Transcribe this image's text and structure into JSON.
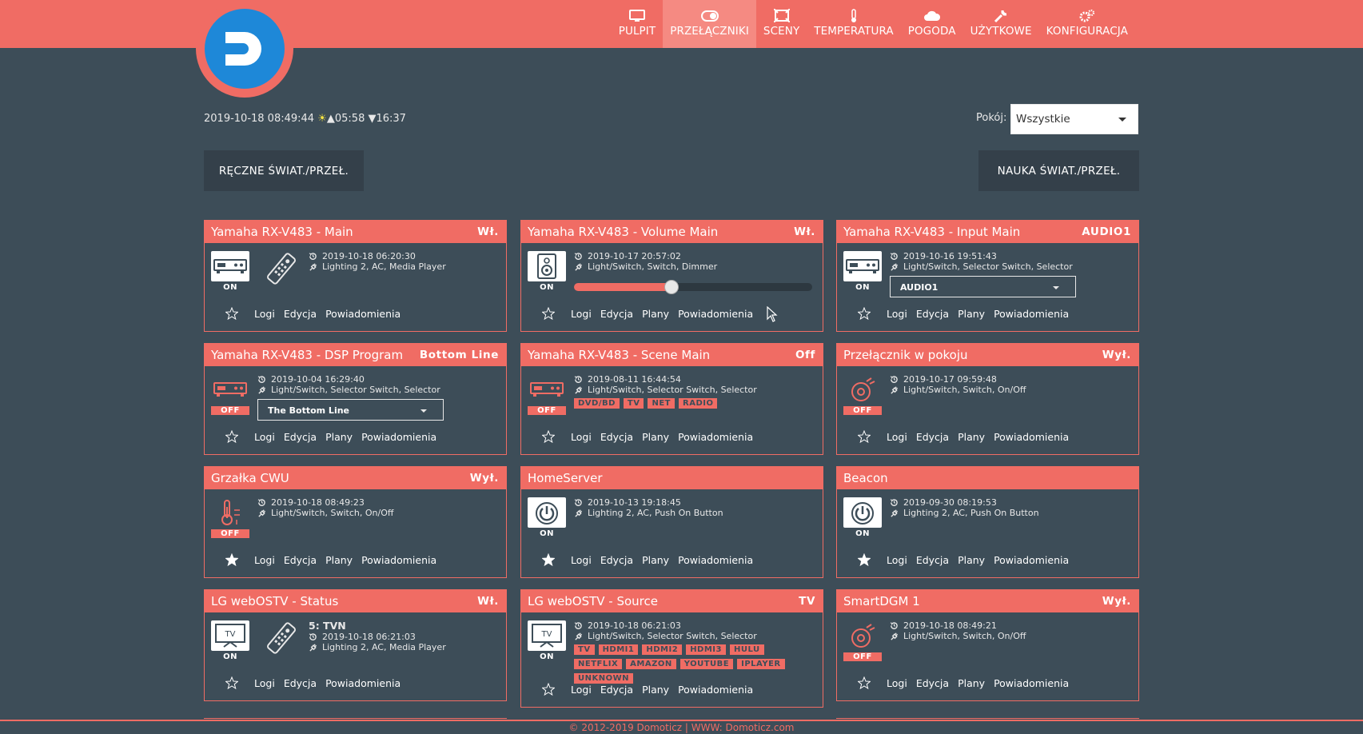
{
  "nav": [
    {
      "label": "PULPIT",
      "icon": "monitor-icon",
      "active": false
    },
    {
      "label": "PRZEŁĄCZNIKI",
      "icon": "toggle-icon",
      "active": true
    },
    {
      "label": "SCENY",
      "icon": "scene-icon",
      "active": false
    },
    {
      "label": "TEMPERATURA",
      "icon": "thermometer-icon",
      "active": false
    },
    {
      "label": "POGODA",
      "icon": "cloud-icon",
      "active": false
    },
    {
      "label": "UŻYTKOWE",
      "icon": "wrench-icon",
      "active": false
    },
    {
      "label": "KONFIGURACJA",
      "icon": "gears-icon",
      "active": false
    }
  ],
  "info": {
    "datetime": "2019-10-18 08:49:44",
    "sun_icon": "☀",
    "sunrise": "▲05:58",
    "sunset": "▼16:37"
  },
  "room": {
    "label": "Pokój:",
    "value": "Wszystkie"
  },
  "buttons": {
    "manual": "RĘCZNE ŚWIAT./PRZEŁ.",
    "learn": "NAUKA ŚWIAT./PRZEŁ."
  },
  "links": {
    "logs": "Logi",
    "edit": "Edycja",
    "plans": "Plany",
    "notify": "Powiadomienia"
  },
  "colors": {
    "accent": "#f06c64",
    "background": "#3d4d58",
    "logo": "#1e88d8"
  },
  "cards": [
    {
      "title": "Yamaha RX-V483 - Main",
      "status": "Wł.",
      "icon": "receiver-icon",
      "state": "ON",
      "on": true,
      "last": "2019-10-18 06:20:30",
      "type": "Lighting 2, AC, Media Player",
      "favorite": false,
      "remote": true
    },
    {
      "title": "Yamaha RX-V483 - Volume Main",
      "status": "Wł.",
      "icon": "speaker-icon",
      "state": "ON",
      "on": true,
      "last": "2019-10-17 20:57:02",
      "type": "Light/Switch, Switch, Dimmer",
      "favorite": false,
      "level": 0.41
    },
    {
      "title": "Yamaha RX-V483 - Input Main",
      "status": "AUDIO1",
      "icon": "receiver-icon",
      "state": "ON",
      "on": true,
      "last": "2019-10-16 19:51:43",
      "type": "Light/Switch, Selector Switch, Selector",
      "favorite": false,
      "select": "AUDIO1"
    },
    {
      "title": "Yamaha RX-V483 - DSP Program",
      "status": "Bottom Line",
      "icon": "receiver-icon",
      "state": "OFF",
      "on": false,
      "last": "2019-10-04 16:29:40",
      "type": "Light/Switch, Selector Switch, Selector",
      "favorite": false,
      "select": "The Bottom Line"
    },
    {
      "title": "Yamaha RX-V483 - Scene Main",
      "status": "Off",
      "icon": "receiver-icon",
      "state": "OFF",
      "on": false,
      "last": "2019-08-11 16:44:54",
      "type": "Light/Switch, Selector Switch, Selector",
      "favorite": false,
      "tags": [
        "DVD/BD",
        "TV",
        "NET",
        "RADIO"
      ]
    },
    {
      "title": "Przełącznik w pokoju",
      "status": "Wył.",
      "icon": "socket-icon",
      "state": "OFF",
      "on": false,
      "last": "2019-10-17 09:59:48",
      "type": "Light/Switch, Switch, On/Off",
      "favorite": false
    },
    {
      "title": "Grzałka CWU",
      "status": "Wył.",
      "icon": "heater-icon",
      "state": "OFF",
      "on": false,
      "last": "2019-10-18 08:49:23",
      "type": "Light/Switch, Switch, On/Off",
      "favorite": true
    },
    {
      "title": "HomeServer",
      "status": "",
      "icon": "power-button-icon",
      "state": "ON",
      "on": true,
      "last": "2019-10-13 19:18:45",
      "type": "Lighting 2, AC, Push On Button",
      "favorite": true
    },
    {
      "title": "Beacon",
      "status": "",
      "icon": "power-button-icon",
      "state": "ON",
      "on": true,
      "last": "2019-09-30 08:19:53",
      "type": "Lighting 2, AC, Push On Button",
      "favorite": true
    },
    {
      "title": "LG webOSTV - Status",
      "status": "Wł.",
      "icon": "tv-icon",
      "state": "ON",
      "on": true,
      "last": "2019-10-18 06:21:03",
      "type": "Lighting 2, AC, Media Player",
      "favorite": false,
      "remote": true,
      "value": "5: TVN"
    },
    {
      "title": "LG webOSTV - Source",
      "status": "TV",
      "icon": "tv-icon",
      "state": "ON",
      "on": true,
      "last": "2019-10-18 06:21:03",
      "type": "Light/Switch, Selector Switch, Selector",
      "favorite": false,
      "tags": [
        "TV",
        "HDMI1",
        "HDMI2",
        "HDMI3",
        "HULU",
        "NETFLIX",
        "AMAZON",
        "YOUTUBE",
        "IPLAYER",
        "UNKNOWN"
      ]
    },
    {
      "title": "SmartDGM 1",
      "status": "Wył.",
      "icon": "socket-icon",
      "state": "OFF",
      "on": false,
      "last": "2019-10-18 08:49:21",
      "type": "Light/Switch, Switch, On/Off",
      "favorite": false
    }
  ],
  "footer": "© 2012-2019 Domoticz | WWW: Domoticz.com"
}
